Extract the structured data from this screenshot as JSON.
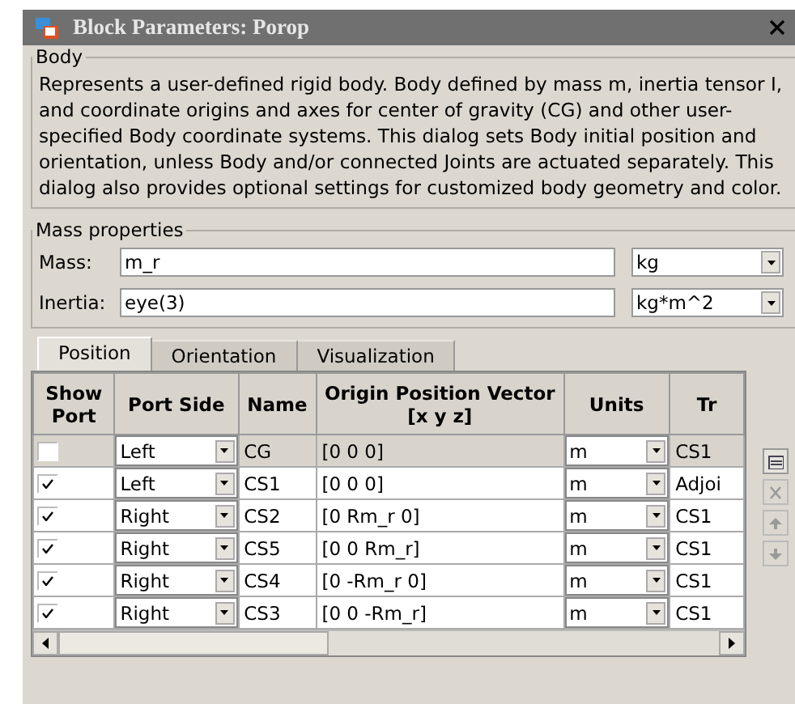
{
  "window": {
    "title": "Block Parameters: Porop"
  },
  "body": {
    "title": "Body",
    "description": "Represents a user-defined rigid body. Body defined by mass m, inertia tensor I, and coordinate origins and axes for center of gravity (CG) and other user-specified Body coordinate systems. This dialog sets Body initial position and orientation, unless Body and/or connected Joints are actuated separately. This dialog also provides optional settings for customized body geometry and color."
  },
  "mass_properties": {
    "title": "Mass properties",
    "fields": [
      {
        "label": "Mass:",
        "value": "m_r",
        "unit": "kg"
      },
      {
        "label": "Inertia:",
        "value": "eye(3)",
        "unit": "kg*m^2"
      }
    ]
  },
  "tabs": [
    {
      "label": "Position",
      "selected": true
    },
    {
      "label": "Orientation",
      "selected": false
    },
    {
      "label": "Visualization",
      "selected": false
    }
  ],
  "table": {
    "columns": [
      "Show Port",
      "Port Side",
      "Name",
      "Origin Position Vector [x y z]",
      "Units",
      "Tr"
    ],
    "rows": [
      {
        "show_port": false,
        "port_side": "Left",
        "name": "CG",
        "origin": "[0 0 0]",
        "units": "m",
        "column_6": "CS1",
        "selected": true
      },
      {
        "show_port": true,
        "port_side": "Left",
        "name": "CS1",
        "origin": "[0 0 0]",
        "units": "m",
        "column_6": "Adjoi",
        "selected": false
      },
      {
        "show_port": true,
        "port_side": "Right",
        "name": "CS2",
        "origin": "[0 Rm_r 0]",
        "units": "m",
        "column_6": "CS1",
        "selected": false
      },
      {
        "show_port": true,
        "port_side": "Right",
        "name": "CS5",
        "origin": "[0 0 Rm_r]",
        "units": "m",
        "column_6": "CS1",
        "selected": false
      },
      {
        "show_port": true,
        "port_side": "Right",
        "name": "CS4",
        "origin": "[0 -Rm_r 0]",
        "units": "m",
        "column_6": "CS1",
        "selected": false
      },
      {
        "show_port": true,
        "port_side": "Right",
        "name": "CS3",
        "origin": "[0 0 -Rm_r]",
        "units": "m",
        "column_6": "CS1",
        "selected": false
      }
    ]
  },
  "side_buttons": [
    {
      "kind": "add",
      "disabled": false
    },
    {
      "kind": "delete",
      "disabled": true
    },
    {
      "kind": "up",
      "disabled": true
    },
    {
      "kind": "down",
      "disabled": true
    }
  ]
}
